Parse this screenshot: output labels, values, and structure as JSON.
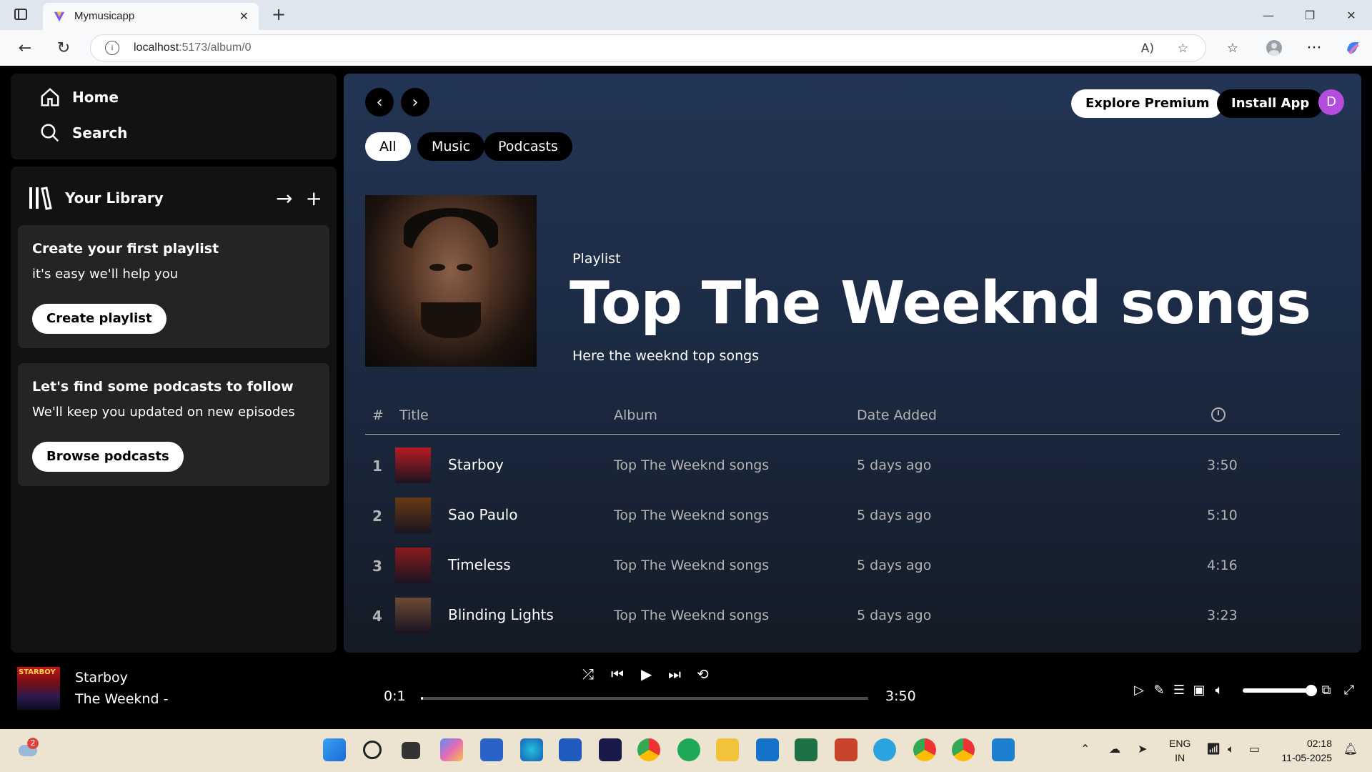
{
  "browser": {
    "tab_title": "Mymusicapp",
    "url_host": "localhost",
    "url_rest": ":5173/album/0"
  },
  "sidebar": {
    "home_label": "Home",
    "search_label": "Search"
  },
  "library": {
    "title": "Your Library",
    "card1": {
      "title": "Create your first playlist",
      "subtitle": "it's easy we'll help you",
      "button": "Create playlist"
    },
    "card2": {
      "title": "Let's find some podcasts to follow",
      "subtitle": "We'll keep you updated on new episodes",
      "button": "Browse podcasts"
    }
  },
  "header": {
    "explore_premium": "Explore Premium",
    "install_app": "Install App",
    "avatar_letter": "D"
  },
  "filters": [
    "All",
    "Music",
    "Podcasts"
  ],
  "playlist": {
    "type": "Playlist",
    "title": "Top The Weeknd songs",
    "description": "Here the weeknd top songs"
  },
  "table": {
    "headers": {
      "num": "#",
      "title": "Title",
      "album": "Album",
      "date": "Date Added"
    },
    "rows": [
      {
        "num": "1",
        "title": "Starboy",
        "album": "Top The Weeknd songs",
        "date": "5 days ago",
        "duration": "3:50",
        "thumb_color": "#b81a24"
      },
      {
        "num": "2",
        "title": "Sao Paulo",
        "album": "Top The Weeknd songs",
        "date": "5 days ago",
        "duration": "5:10",
        "thumb_color": "#6a3a12"
      },
      {
        "num": "3",
        "title": "Timeless",
        "album": "Top The Weeknd songs",
        "date": "5 days ago",
        "duration": "4:16",
        "thumb_color": "#8a1a1e"
      },
      {
        "num": "4",
        "title": "Blinding Lights",
        "album": "Top The Weeknd songs",
        "date": "5 days ago",
        "duration": "3:23",
        "thumb_color": "#6e4a36"
      }
    ]
  },
  "player": {
    "track_title": "Starboy",
    "track_artist": "The Weeknd -",
    "art_text": "STARBOY",
    "elapsed": "0:1",
    "total": "3:50",
    "progress": 0.004,
    "volume": 1.0
  },
  "taskbar": {
    "notification_count": "2",
    "lang_line1": "ENG",
    "lang_line2": "IN",
    "time": "02:18",
    "date": "11-05-2025"
  },
  "colors": {
    "accent_avatar": "#b44dde",
    "main_gradient_top": "#233555",
    "panel_bg": "#121212",
    "card_bg": "#242424"
  }
}
